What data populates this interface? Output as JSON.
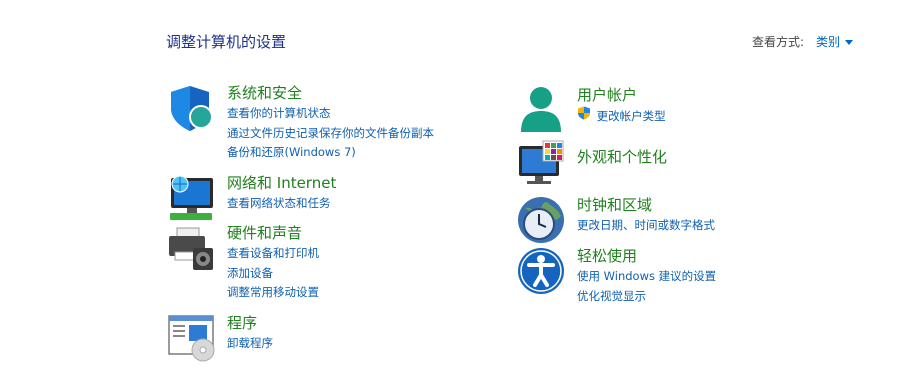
{
  "header": {
    "title": "调整计算机的设置",
    "view_by_label": "查看方式:",
    "view_by_value": "类别"
  },
  "categories": {
    "system_security": {
      "title": "系统和安全",
      "links": [
        "查看你的计算机状态",
        "通过文件历史记录保存你的文件备份副本",
        "备份和还原(Windows 7)"
      ]
    },
    "network": {
      "title": "网络和 Internet",
      "links": [
        "查看网络状态和任务"
      ]
    },
    "hardware": {
      "title": "硬件和声音",
      "links": [
        "查看设备和打印机",
        "添加设备",
        "调整常用移动设置"
      ]
    },
    "programs": {
      "title": "程序",
      "links": [
        "卸载程序"
      ]
    },
    "user_accounts": {
      "title": "用户帐户",
      "links": [
        "更改帐户类型"
      ]
    },
    "appearance": {
      "title": "外观和个性化",
      "links": []
    },
    "clock_region": {
      "title": "时钟和区域",
      "links": [
        "更改日期、时间或数字格式"
      ]
    },
    "ease_of_access": {
      "title": "轻松使用",
      "links": [
        "使用 Windows 建议的设置",
        "优化视觉显示"
      ]
    }
  },
  "colors": {
    "category_title": "#21801f",
    "link": "#1060b0",
    "page_title": "#1e3287"
  }
}
